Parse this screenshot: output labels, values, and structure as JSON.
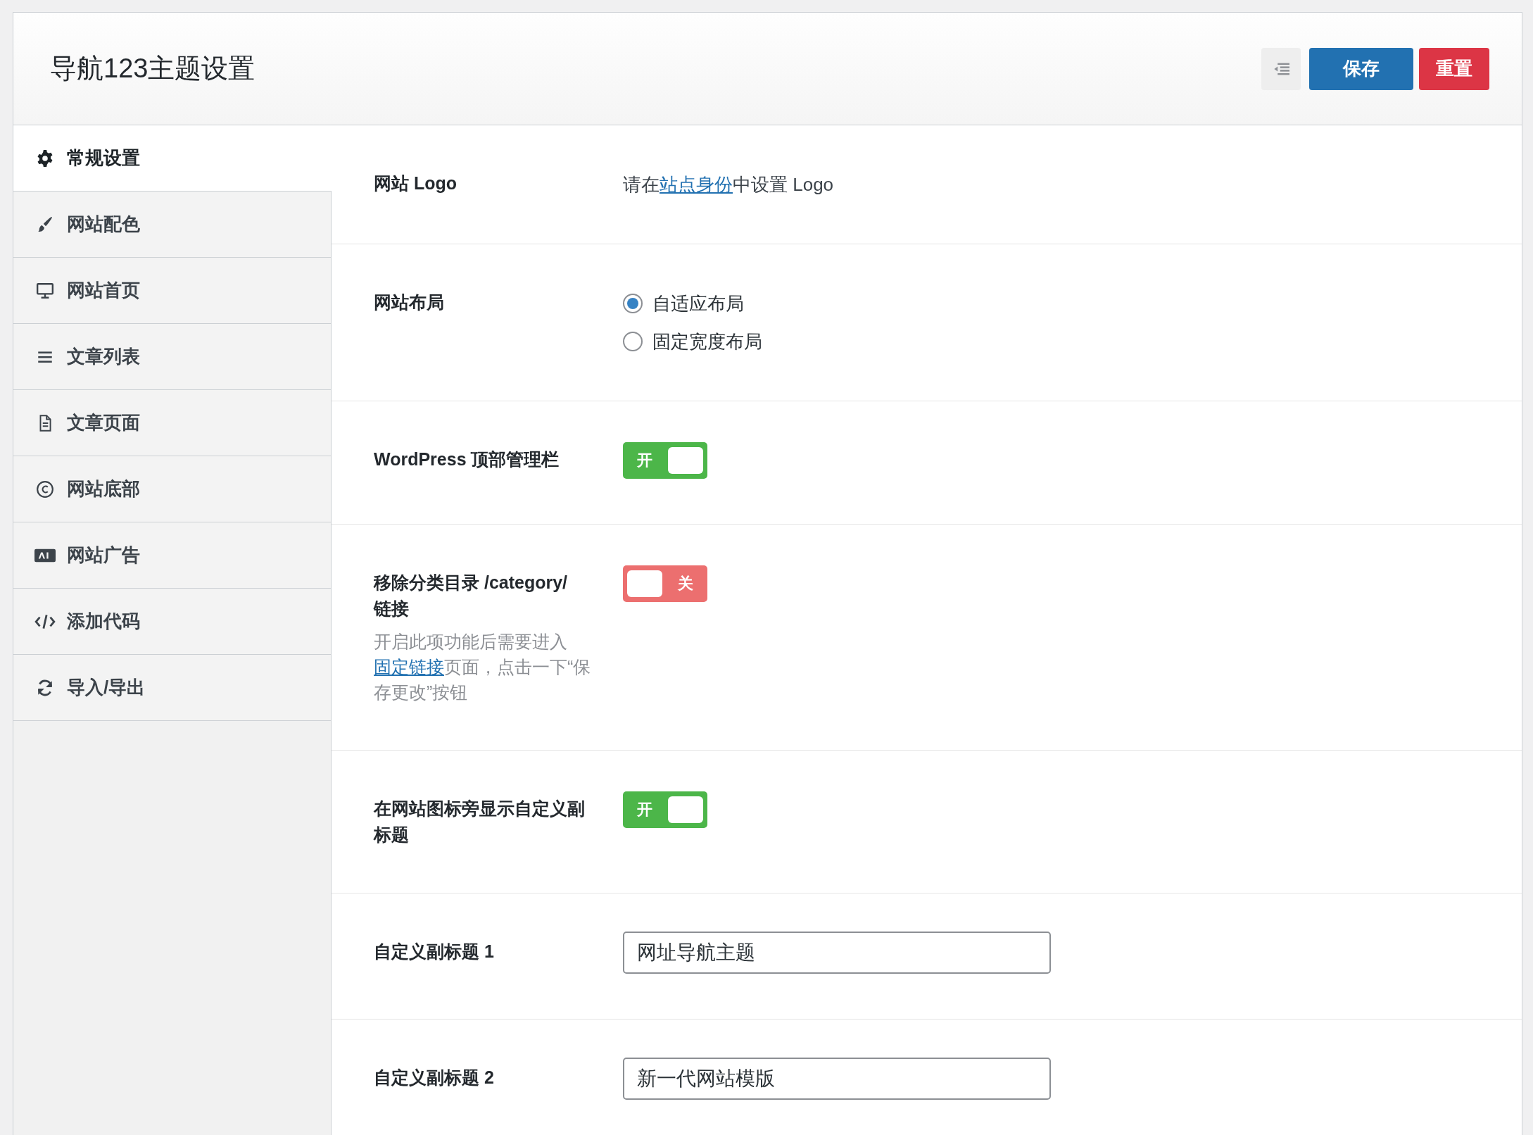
{
  "header": {
    "title": "导航123主题设置",
    "buttons": [
      {
        "kind": "icon"
      },
      {
        "kind": "primary",
        "label": "保存"
      },
      {
        "kind": "danger",
        "label": "重置"
      }
    ]
  },
  "sidebar": {
    "items": [
      {
        "label": "常规设置",
        "selected": true
      },
      {
        "label": "网站配色",
        "selected": false
      },
      {
        "label": "网站首页",
        "selected": false
      },
      {
        "label": "文章列表",
        "selected": false
      },
      {
        "label": "文章页面",
        "selected": false
      },
      {
        "label": "网站底部",
        "selected": false
      },
      {
        "label": "网站广告",
        "selected": false
      },
      {
        "label": "添加代码",
        "selected": false
      },
      {
        "label": "导入/导出",
        "selected": false
      }
    ]
  },
  "settings": [
    {
      "kind": "text",
      "label": "网站 Logo",
      "value": {
        "before": "请在",
        "link": "站点身份",
        "after": "中设置 Logo"
      }
    },
    {
      "kind": "radio",
      "label": "网站布局",
      "options": [
        {
          "label": "自适应布局",
          "selected": true
        },
        {
          "label": "固定宽度布局",
          "selected": false
        }
      ]
    },
    {
      "kind": "toggle",
      "label": "WordPress 顶部管理栏",
      "toggle": {
        "on": true,
        "label": "开"
      }
    },
    {
      "kind": "toggle",
      "label": "移除分类目录 /category/ 链接",
      "description": {
        "before": "开启此项功能后需要进入",
        "link": "固定链接",
        "after": "页面，点击一下“保存更改”按钮"
      },
      "toggle": {
        "on": false,
        "label": "关"
      }
    },
    {
      "kind": "toggle",
      "label": "在网站图标旁显示自定义副标题",
      "toggle": {
        "on": true,
        "label": "开"
      }
    },
    {
      "kind": "input",
      "label": "自定义副标题 1",
      "value": "网址导航主题"
    },
    {
      "kind": "input",
      "label": "自定义副标题 2",
      "value": "新一代网站模版"
    }
  ]
}
